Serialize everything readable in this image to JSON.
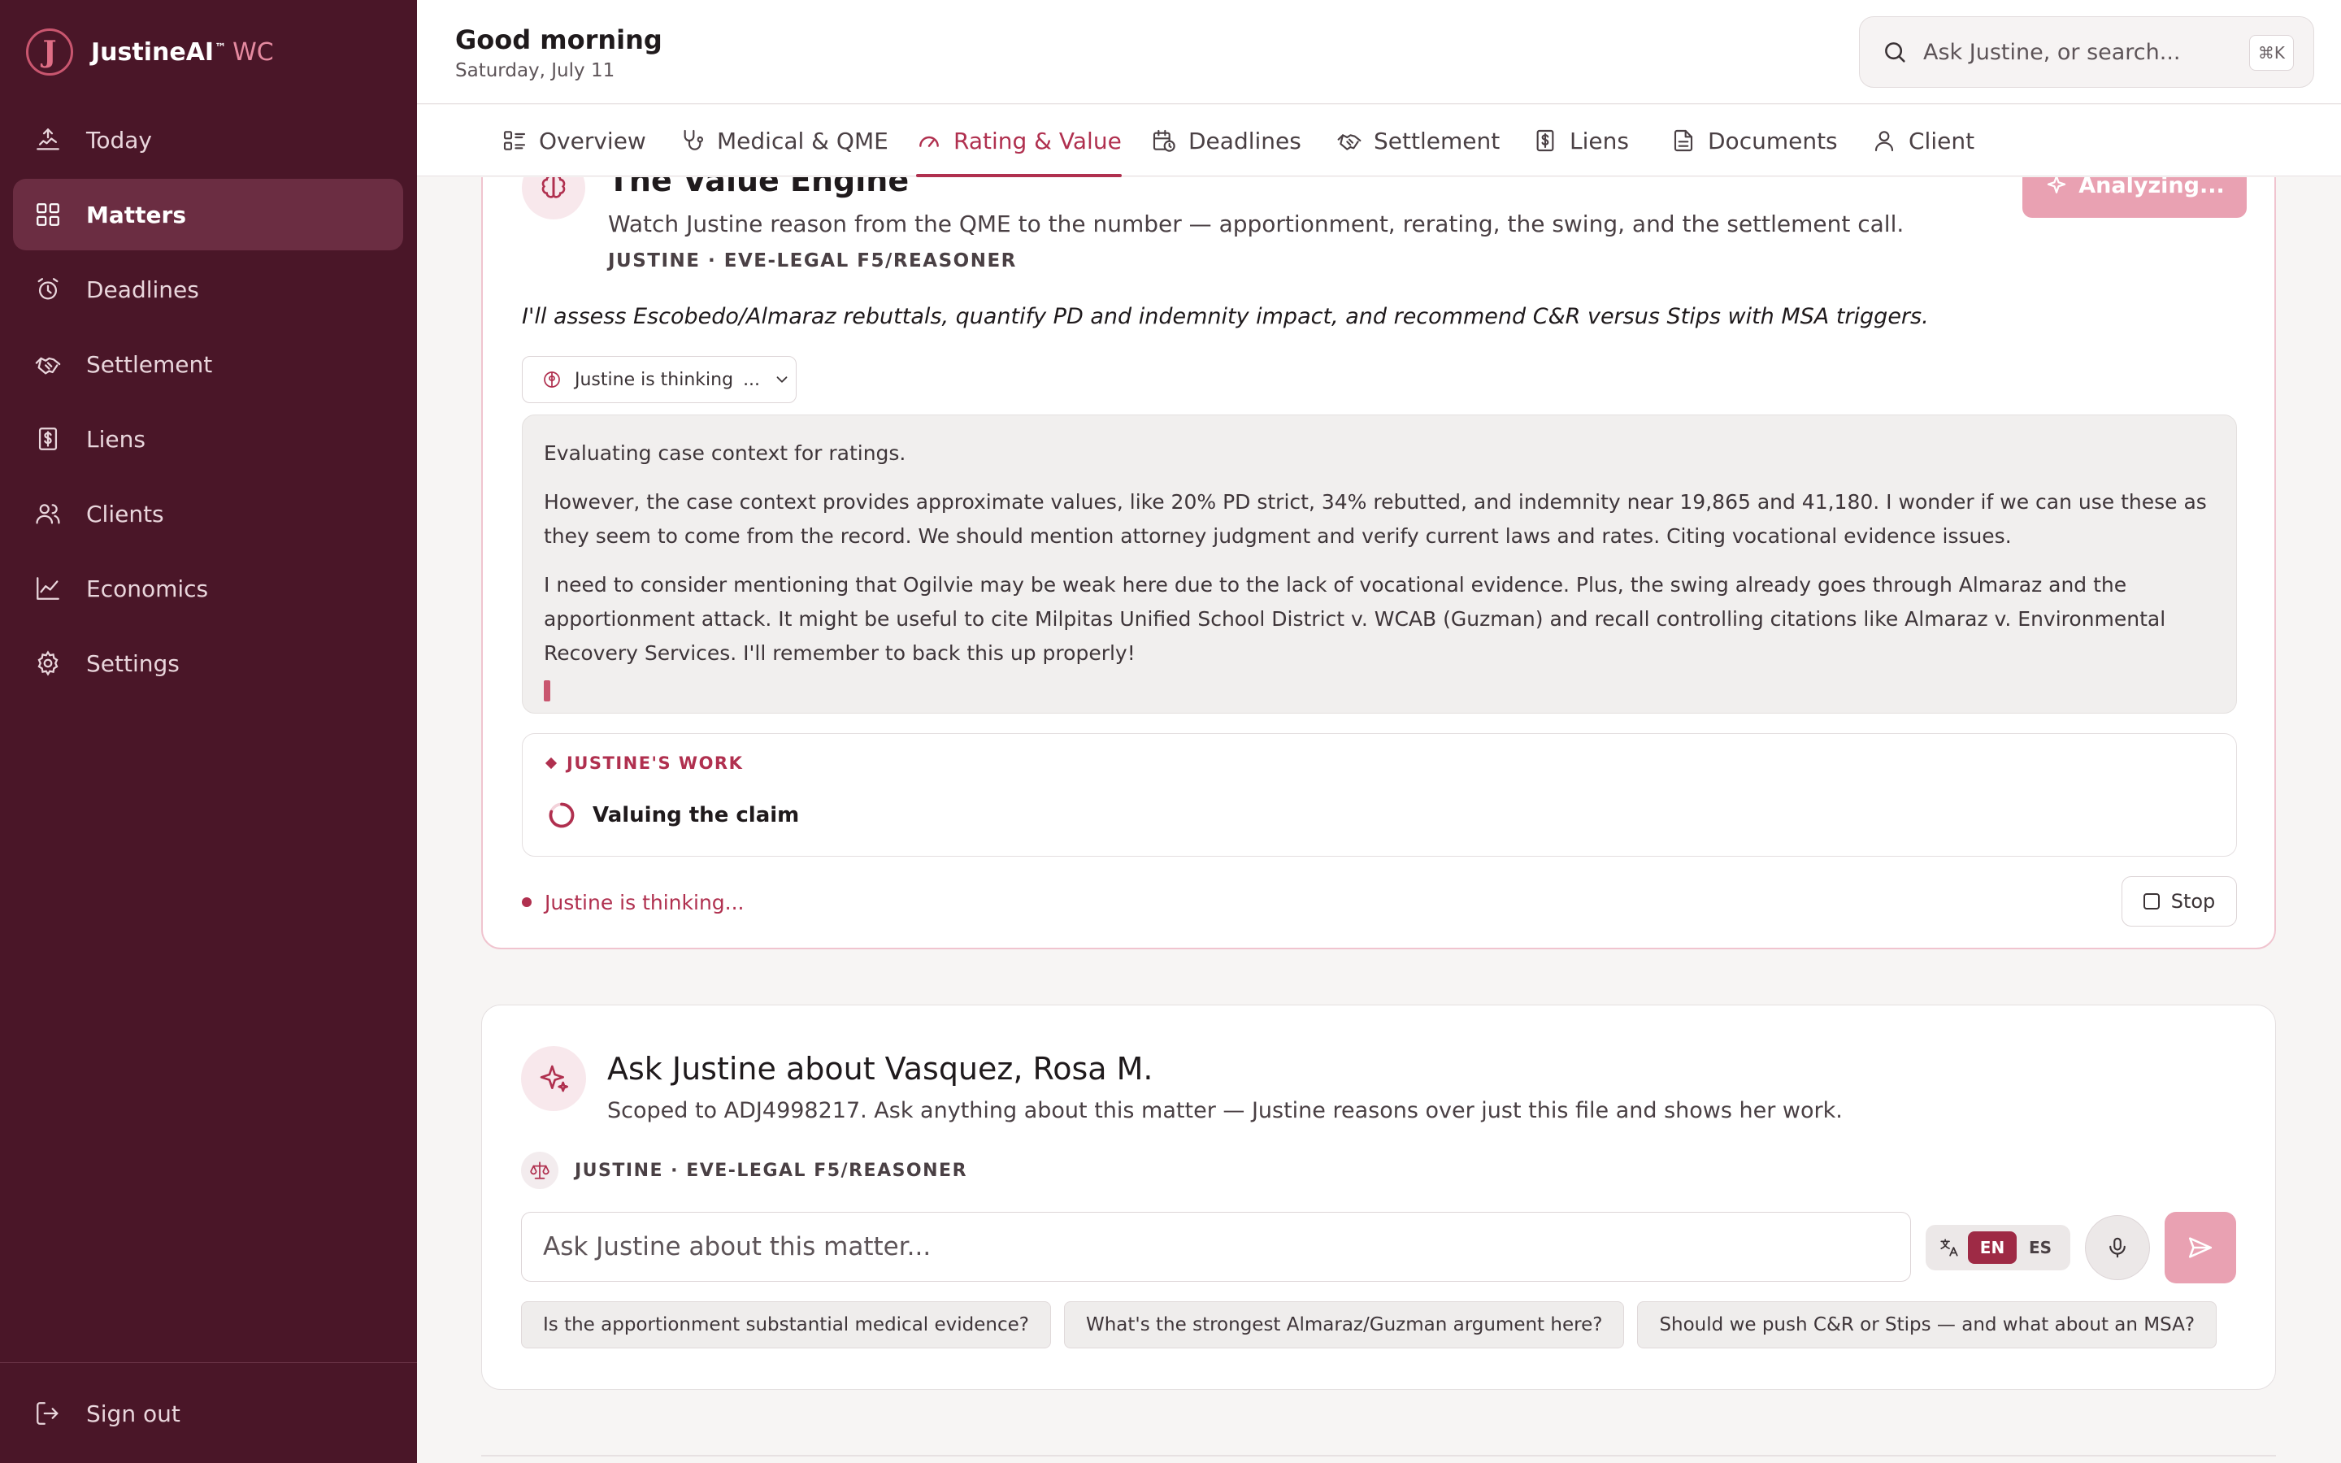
{
  "brand": {
    "initial": "J",
    "name": "JustineAI",
    "tm": "™",
    "suffix": "WC"
  },
  "sidebar": {
    "items": [
      {
        "label": "Today",
        "icon": "today-icon",
        "active": false
      },
      {
        "label": "Matters",
        "icon": "grid-icon",
        "active": true
      },
      {
        "label": "Deadlines",
        "icon": "alarm-clock-icon",
        "active": false
      },
      {
        "label": "Settlement",
        "icon": "handshake-icon",
        "active": false
      },
      {
        "label": "Liens",
        "icon": "dollar-document-icon",
        "active": false
      },
      {
        "label": "Clients",
        "icon": "users-icon",
        "active": false
      },
      {
        "label": "Economics",
        "icon": "line-chart-icon",
        "active": false
      },
      {
        "label": "Settings",
        "icon": "gear-icon",
        "active": false
      }
    ],
    "signout": "Sign out"
  },
  "header": {
    "greeting": "Good morning",
    "date": "Saturday, July 11",
    "search_placeholder": "Ask Justine, or search...",
    "shortcut": "⌘K"
  },
  "tabs": [
    {
      "label": "Overview",
      "icon": "overview-icon"
    },
    {
      "label": "Medical & QME",
      "icon": "stethoscope-icon"
    },
    {
      "label": "Rating & Value",
      "icon": "gauge-icon",
      "active": true
    },
    {
      "label": "Deadlines",
      "icon": "calendar-clock-icon"
    },
    {
      "label": "Settlement",
      "icon": "handshake-icon"
    },
    {
      "label": "Liens",
      "icon": "dollar-document-icon"
    },
    {
      "label": "Documents",
      "icon": "document-icon"
    },
    {
      "label": "Client",
      "icon": "user-icon"
    }
  ],
  "engine": {
    "title": "The Value Engine",
    "subtitle": "Watch Justine reason from the QME to the number — apportionment, rerating, the swing, and the settlement call.",
    "model": "JUSTINE · EVE-LEGAL F5/REASONER",
    "button": "Analyzing...",
    "intro": "I'll assess Escobedo/Almaraz rebuttals, quantify PD and indemnity impact, and recommend C&R versus Stips with MSA triggers.",
    "thinking_toggle": "Justine is thinking",
    "thinking_ellipsis": "...",
    "reasoning": [
      "Evaluating case context for ratings.",
      "However, the case context provides approximate values, like 20% PD strict, 34% rebutted, and indemnity near 19,865 and 41,180. I wonder if we can use these as they seem to come from the record. We should mention attorney judgment and verify current laws and rates. Citing vocational evidence issues.",
      "I need to consider mentioning that Ogilvie may be weak here due to the lack of vocational evidence. Plus, the swing already goes through Almaraz and the apportionment attack. It might be useful to cite Milpitas Unified School District v. WCAB (Guzman) and recall controlling citations like Almaraz v. Environmental Recovery Services. I'll remember to back this up properly!"
    ],
    "work_heading": "JUSTINE'S WORK",
    "work_item": "Valuing the claim",
    "status": "Justine is thinking...",
    "stop": "Stop"
  },
  "ask": {
    "title": "Ask Justine about Vasquez, Rosa M.",
    "subtitle": "Scoped to ADJ4998217. Ask anything about this matter — Justine reasons over just this file and shows her work.",
    "model": "JUSTINE · EVE-LEGAL F5/REASONER",
    "placeholder": "Ask Justine about this matter...",
    "lang_en": "EN",
    "lang_es": "ES",
    "suggestions": [
      "Is the apportionment substantial medical evidence?",
      "What's the strongest Almaraz/Guzman argument here?",
      "Should we push C&R or Stips — and what about an MSA?"
    ]
  },
  "colors": {
    "sidebar": "#4a1628",
    "accent": "#b0304f",
    "accent_soft": "#e9a1b2"
  }
}
